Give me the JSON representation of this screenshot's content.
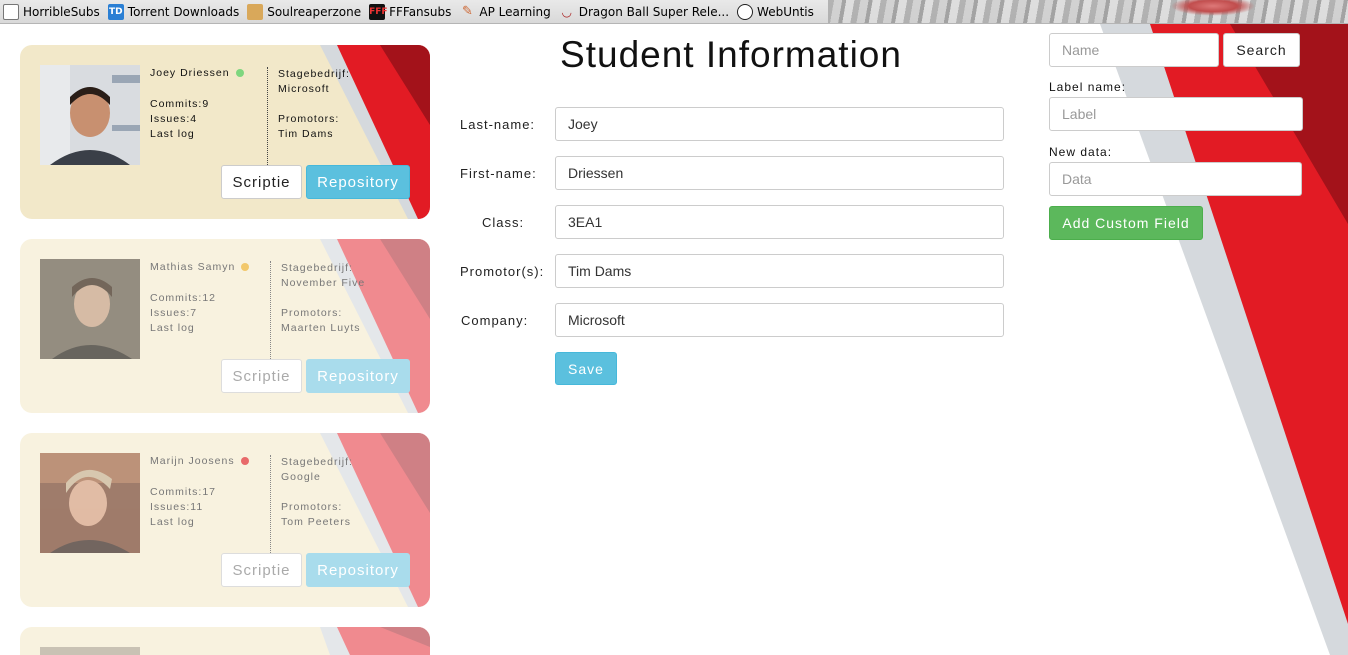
{
  "bookmarks": [
    {
      "label": "HorribleSubs",
      "icon": "horriblesubs-icon"
    },
    {
      "label": "Torrent Downloads",
      "icon": "td-icon"
    },
    {
      "label": "Soulreaperzone",
      "icon": "soulreaperzone-icon"
    },
    {
      "label": "FFFansubs",
      "icon": "fff-icon"
    },
    {
      "label": "AP Learning",
      "icon": "ap-learning-icon"
    },
    {
      "label": "Dragon Ball Super Rele...",
      "icon": "dragonball-icon"
    },
    {
      "label": "WebUntis",
      "icon": "clock-icon"
    }
  ],
  "students": [
    {
      "name": "Joey Driessen",
      "status_color": "#7ed67e",
      "commits": "Commits:9",
      "issues": "Issues:4",
      "last_log": "Last log",
      "company_label": "Stagebedrijf:",
      "company": "Microsoft",
      "promotors_label": "Promotors:",
      "promotors": "Tim Dams",
      "scriptie_label": "Scriptie",
      "repository_label": "Repository"
    },
    {
      "name": "Mathias Samyn",
      "status_color": "#f2c86b",
      "commits": "Commits:12",
      "issues": "Issues:7",
      "last_log": "Last log",
      "company_label": "Stagebedrijf:",
      "company": "November Five",
      "promotors_label": "Promotors:",
      "promotors": "Maarten Luyts",
      "scriptie_label": "Scriptie",
      "repository_label": "Repository"
    },
    {
      "name": "Marijn Joosens",
      "status_color": "#e86a6a",
      "commits": "Commits:17",
      "issues": "Issues:11",
      "last_log": "Last log",
      "company_label": "Stagebedrijf:",
      "company": "Google",
      "promotors_label": "Promotors:",
      "promotors": "Tom Peeters",
      "scriptie_label": "Scriptie",
      "repository_label": "Repository"
    }
  ],
  "form": {
    "title": "Student Information",
    "fields": [
      {
        "label": "Last-name:",
        "value": "Joey"
      },
      {
        "label": "First-name:",
        "value": "Driessen"
      },
      {
        "label": "Class:",
        "value": "3EA1"
      },
      {
        "label": "Promotor(s):",
        "value": "Tim Dams"
      },
      {
        "label": "Company:",
        "value": "Microsoft"
      }
    ],
    "save_label": "Save"
  },
  "right_panel": {
    "search_placeholder": "Name",
    "search_label": "Search",
    "label_name_label": "Label name:",
    "label_placeholder": "Label",
    "new_data_label": "New data:",
    "data_placeholder": "Data",
    "add_field_label": "Add Custom Field"
  },
  "colors": {
    "accent_red": "#e21b24",
    "info_blue": "#5bc0de",
    "success_green": "#5cb85c",
    "card_bg": "#f2e8c9"
  }
}
